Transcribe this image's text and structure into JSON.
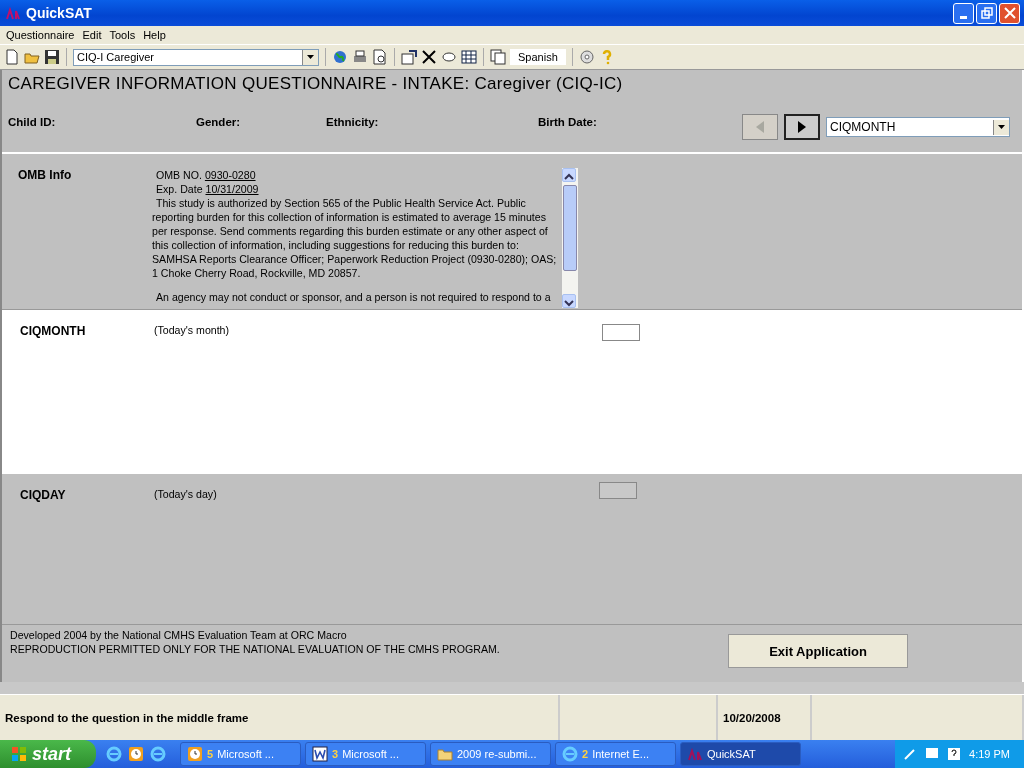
{
  "window": {
    "title": "QuickSAT"
  },
  "menu": [
    "Questionnaire",
    "Edit",
    "Tools",
    "Help"
  ],
  "toolbar": {
    "questionnaire_select": "CIQ-I Caregiver",
    "language_button": "Spanish"
  },
  "form_title": "CAREGIVER INFORMATION QUESTIONNAIRE - INTAKE: Caregiver (CIQ-IC)",
  "header_fields": [
    "Child ID:",
    "Gender:",
    "Ethnicity:",
    "Birth Date:"
  ],
  "navigation": {
    "previous_disabled": true,
    "next_disabled": false,
    "question_select": "CIQMONTH"
  },
  "omb": {
    "label": "OMB Info",
    "omb_no_label": "OMB NO.",
    "omb_no": "0930-0280",
    "exp_label": "Exp. Date",
    "exp_date": "10/31/2009",
    "paragraph": "This study is authorized by Section 565 of the Public Health Service Act.  Public reporting burden for this collection of information is estimated to average 15 minutes per response.  Send comments regarding this burden estimate or any other aspect of this collection of information, including suggestions for reducing this burden to: SAMHSA Reports Clearance Officer; Paperwork Reduction Project (0930-0280); OAS; 1 Choke Cherry Road, Rockville, MD 20857.",
    "paragraph_2": "An agency may not conduct or sponsor, and a person is not required to respond to a"
  },
  "questions": [
    {
      "name": "CIQMONTH",
      "prompt": "(Today's month)",
      "selected": true
    },
    {
      "name": "CIQDAY",
      "prompt": "(Today's day)",
      "selected": false
    }
  ],
  "footer": {
    "credit": "Developed 2004 by the National CMHS Evaluation Team at ORC Macro",
    "notice": "REPRODUCTION PERMITTED ONLY FOR THE NATIONAL EVALUATION OF THE CMHS PROGRAM.",
    "exit_button": "Exit Application"
  },
  "status_bar": {
    "message": "Respond to the question in the middle frame",
    "date": "10/20/2008"
  },
  "taskbar": {
    "start": "start",
    "tasks": [
      {
        "count": "5",
        "label": "Microsoft ...",
        "kind": "clock",
        "selected": false
      },
      {
        "count": "3",
        "label": "Microsoft ...",
        "kind": "word",
        "selected": false
      },
      {
        "label": "2009 re-submi...",
        "kind": "folder",
        "selected": false
      },
      {
        "count": "2",
        "label": "Internet E...",
        "kind": "ie",
        "selected": false
      },
      {
        "label": "QuickSAT",
        "kind": "app",
        "selected": true
      }
    ],
    "clock": "4:19 PM"
  }
}
